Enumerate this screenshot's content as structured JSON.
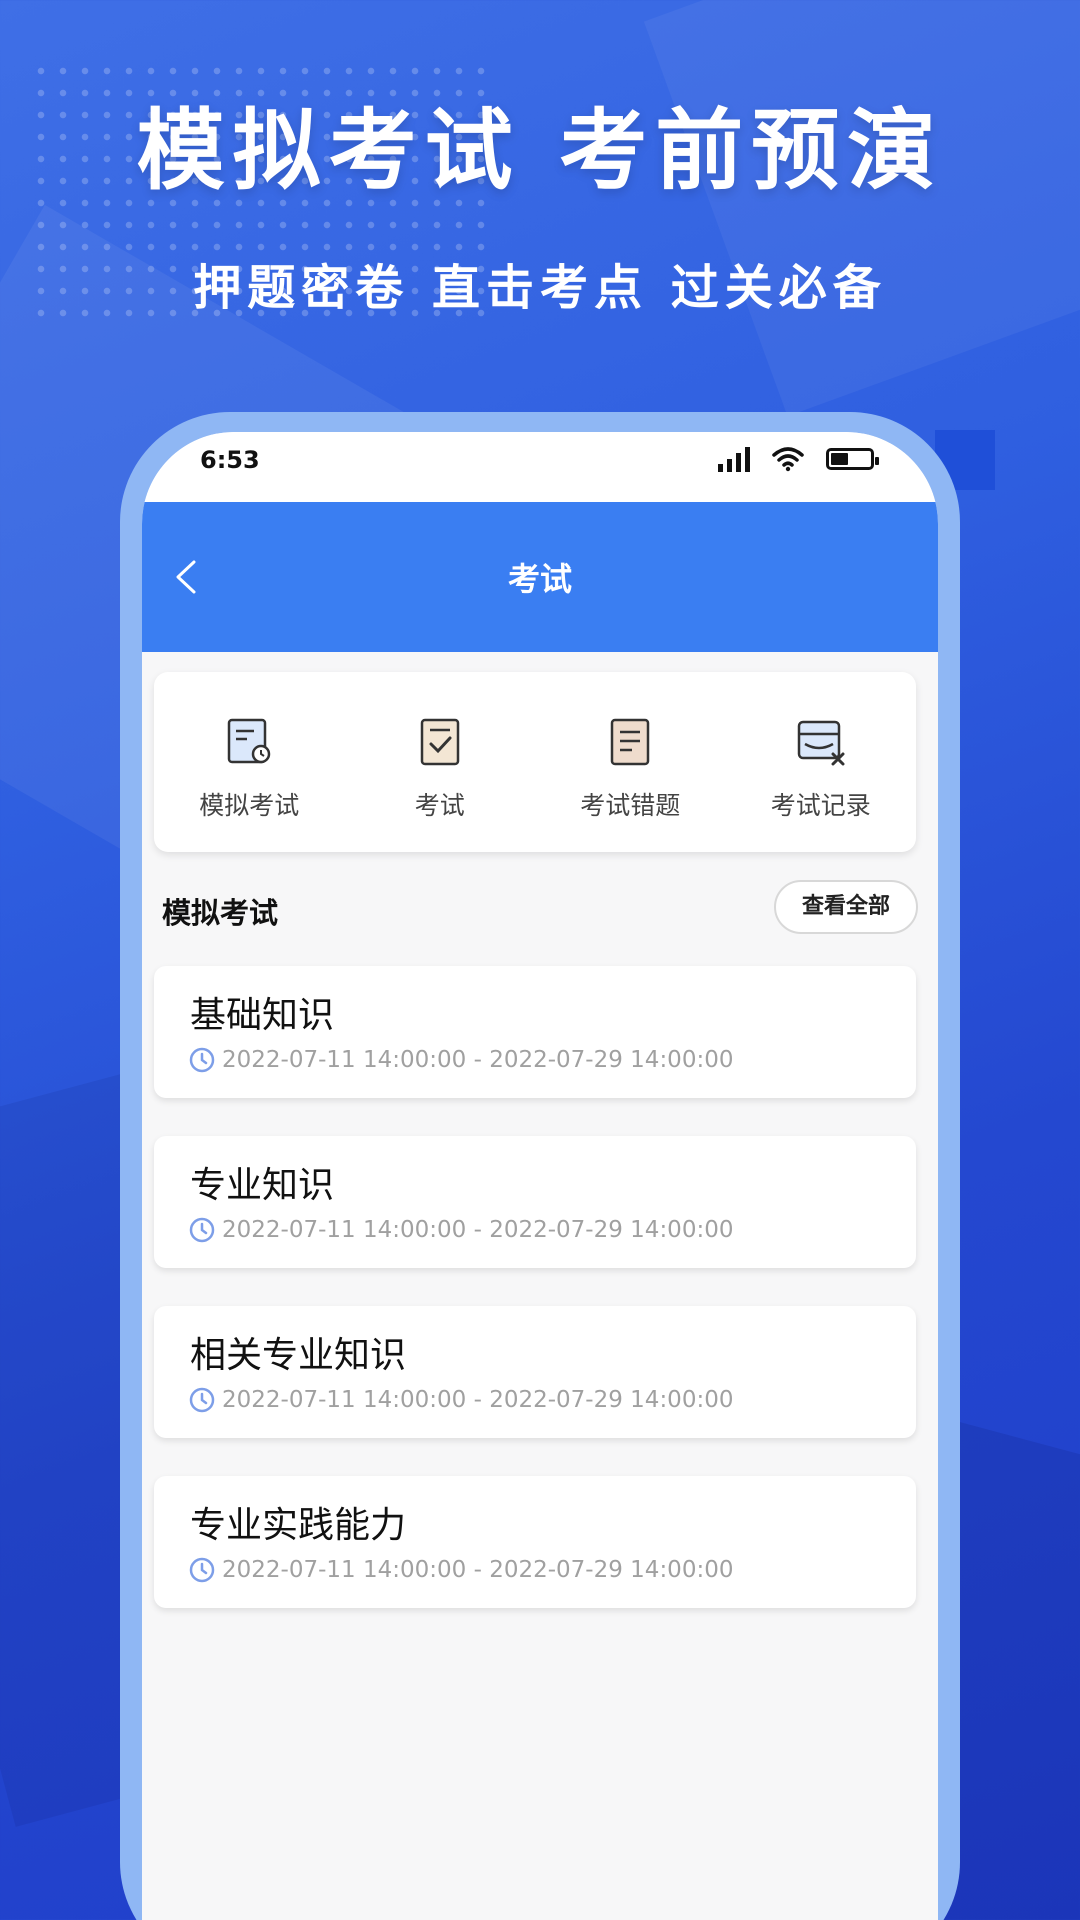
{
  "banner": {
    "headline": "模拟考试 考前预演",
    "subline": "押题密卷 直击考点 过关必备"
  },
  "status_bar": {
    "time": "6:53",
    "icons": [
      "signal-icon",
      "wifi-icon",
      "battery-icon"
    ]
  },
  "navbar": {
    "title": "考试",
    "back_icon": "chevron-left-icon",
    "color": "#3a7ef2"
  },
  "menu": {
    "items": [
      {
        "label": "模拟考试",
        "icon": "mock-exam-icon"
      },
      {
        "label": "考试",
        "icon": "exam-check-icon"
      },
      {
        "label": "考试错题",
        "icon": "wrong-questions-icon"
      },
      {
        "label": "考试记录",
        "icon": "exam-record-icon"
      }
    ]
  },
  "section": {
    "title": "模拟考试",
    "view_all_label": "查看全部"
  },
  "exams": [
    {
      "name": "基础知识",
      "time": "2022-07-11 14:00:00 - 2022-07-29 14:00:00"
    },
    {
      "name": "专业知识",
      "time": "2022-07-11 14:00:00 - 2022-07-29 14:00:00"
    },
    {
      "name": "相关专业知识",
      "time": "2022-07-11 14:00:00 - 2022-07-29 14:00:00"
    },
    {
      "name": "专业实践能力",
      "time": "2022-07-11 14:00:00 - 2022-07-29 14:00:00"
    }
  ]
}
